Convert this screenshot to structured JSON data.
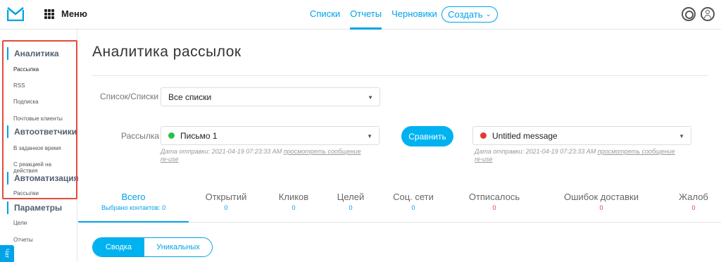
{
  "header": {
    "menu_label": "Меню",
    "nav": [
      "Списки",
      "Отчеты",
      "Черновики"
    ],
    "create_label": "Создать"
  },
  "sidebar": {
    "sections": [
      {
        "title": "Аналитика",
        "items": [
          "Рассылка",
          "RSS",
          "Подписка",
          "Почтовые клиенты"
        ]
      },
      {
        "title": "Автоответчики",
        "items": [
          "В заданное время",
          "С реакцией на действия"
        ]
      },
      {
        "title": "Автоматизация",
        "items": [
          "Рассылки"
        ]
      },
      {
        "title": "Параметры",
        "items": [
          "Цели",
          "Отчеты"
        ]
      }
    ],
    "chat_label": "Чат"
  },
  "page": {
    "title": "Аналитика рассылок",
    "list_label": "Список/Списки",
    "list_value": "Все списки",
    "mailing_label": "Рассылка",
    "mail_a": {
      "name": "Письмо 1",
      "status_color": "#27c24c",
      "sent_prefix": "Дата отправки: 2021-04-19 07:23:33 AM",
      "view_link": "просмотреть сообщение",
      "reuse_link": "re-use"
    },
    "compare_label": "Сравнить",
    "mail_b": {
      "name": "Untitled message",
      "status_color": "#e53935",
      "sent_prefix": "Дата отправки: 2021-04-19 07:23:33 AM",
      "view_link": "просмотреть сообщение",
      "reuse_link": "re-use"
    }
  },
  "stats": {
    "all_label": "Всего",
    "all_sub": "Выбрано контактов:",
    "all_value": "0",
    "items": [
      {
        "label": "Открытий",
        "value": "0"
      },
      {
        "label": "Кликов",
        "value": "0"
      },
      {
        "label": "Целей",
        "value": "0"
      },
      {
        "label": "Соц. сети",
        "value": "0"
      },
      {
        "label": "Отписалось",
        "value": "0"
      },
      {
        "label": "Ошибок доставки",
        "value": "0"
      },
      {
        "label": "Жалоб",
        "value": "0"
      }
    ]
  },
  "tabs": {
    "summary": "Сводка",
    "unique": "Уникальных"
  },
  "colors": {
    "accent": "#00a2e8",
    "highlight_box": "#e24b3c",
    "negative_value": "#e53935"
  }
}
